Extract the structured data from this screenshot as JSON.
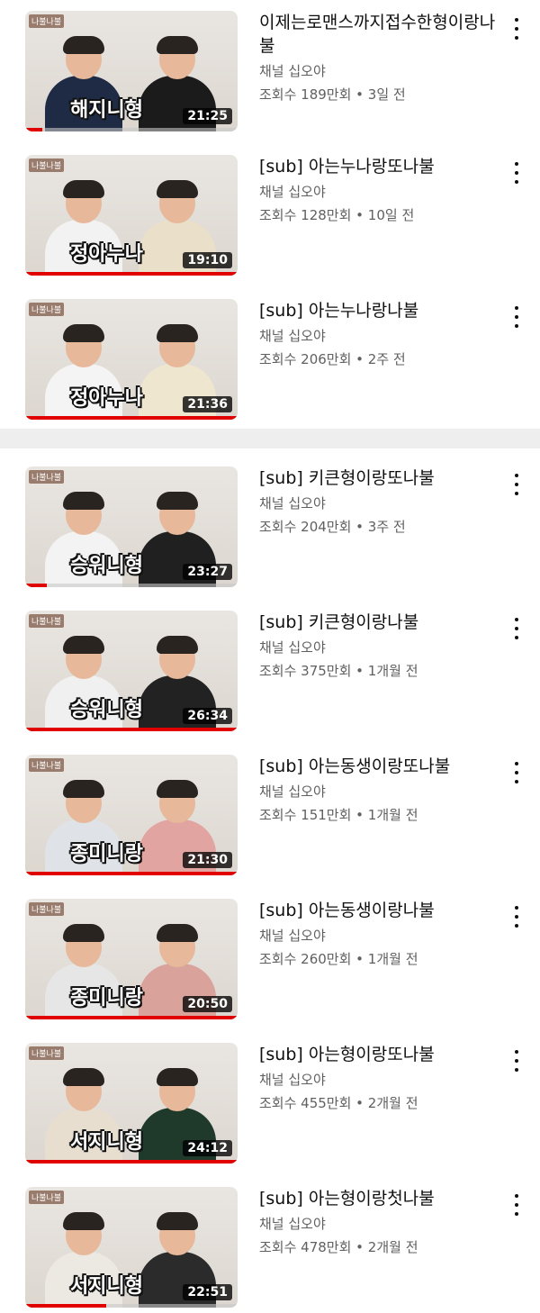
{
  "videos": [
    {
      "title": "이제는로맨스까지접수한형이랑나불",
      "channel": "채널 십오야",
      "meta": "조회수 189만회 • 3일 전",
      "duration": "21:25",
      "caption": "해지니형",
      "progress": 0.08
    },
    {
      "title": "[sub] 아는누나랑또나불",
      "channel": "채널 십오야",
      "meta": "조회수 128만회 • 10일 전",
      "duration": "19:10",
      "caption": "정아누나",
      "progress": 1.0
    },
    {
      "title": "[sub] 아는누나랑나불",
      "channel": "채널 십오야",
      "meta": "조회수 206만회 • 2주 전",
      "duration": "21:36",
      "caption": "정아누나",
      "progress": 1.0
    },
    {
      "title": "[sub] 키큰형이랑또나불",
      "channel": "채널 십오야",
      "meta": "조회수 204만회 • 3주 전",
      "duration": "23:27",
      "caption": "승워니형",
      "progress": 0.1
    },
    {
      "title": "[sub] 키큰형이랑나불",
      "channel": "채널 십오야",
      "meta": "조회수 375만회 • 1개월 전",
      "duration": "26:34",
      "caption": "승워니형",
      "progress": 1.0
    },
    {
      "title": "[sub] 아는동생이랑또나불",
      "channel": "채널 십오야",
      "meta": "조회수 151만회 • 1개월 전",
      "duration": "21:30",
      "caption": "종미니랑",
      "progress": 1.0
    },
    {
      "title": "[sub] 아는동생이랑나불",
      "channel": "채널 십오야",
      "meta": "조회수 260만회 • 1개월 전",
      "duration": "20:50",
      "caption": "종미니랑",
      "progress": 1.0
    },
    {
      "title": "[sub] 아는형이랑또나불",
      "channel": "채널 십오야",
      "meta": "조회수 455만회 • 2개월 전",
      "duration": "24:12",
      "caption": "서지니형",
      "progress": 1.0
    },
    {
      "title": "[sub] 아는형이랑첫나불",
      "channel": "채널 십오야",
      "meta": "조회수 478만회 • 2개월 전",
      "duration": "22:51",
      "caption": "서지니형",
      "progress": 0.38
    }
  ],
  "icons": {
    "more": "more-vert-icon"
  },
  "colors": {
    "progress": "#e00000",
    "meta": "#606060",
    "title": "#0f0f0f"
  }
}
